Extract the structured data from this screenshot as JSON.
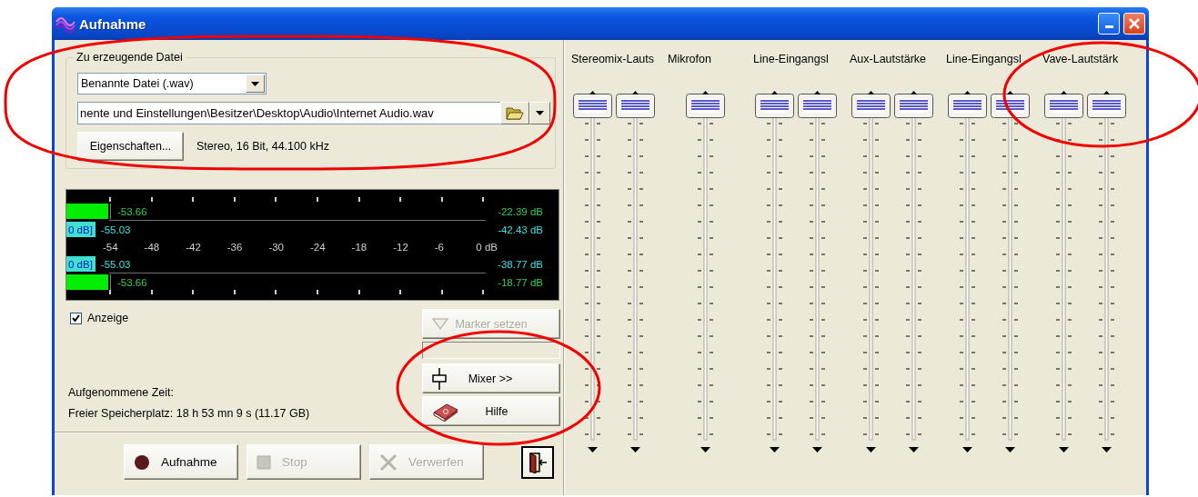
{
  "window": {
    "title": "Aufnahme"
  },
  "file_group": {
    "title": "Zu erzeugende Datei",
    "file_type": "Benannte Datei (.wav)",
    "path": "nente und Einstellungen\\Besitzer\\Desktop\\Audio\\Internet Audio.wav",
    "properties_button": "Eigenschaften...",
    "format": "Stereo, 16 Bit, 44.100 kHz"
  },
  "meter": {
    "rows": [
      {
        "kind": "bar",
        "level": 0.1,
        "value": "-53.66",
        "reading": "-22.39 dB"
      },
      {
        "kind": "tag",
        "tag": "0 dB]",
        "value": "-55.03",
        "reading": "-42.43 dB"
      },
      {
        "kind": "scale",
        "labels": [
          "-54",
          "-48",
          "-42",
          "-36",
          "-30",
          "-24",
          "-18",
          "-12",
          "-6",
          "0 dB"
        ]
      },
      {
        "kind": "tag",
        "tag": "0 dB]",
        "value": "-55.03",
        "reading": "-38.77 dB"
      },
      {
        "kind": "bar",
        "level": 0.1,
        "value": "-53.66",
        "reading": "-18.77 dB"
      }
    ]
  },
  "display_checkbox": {
    "label": "Anzeige",
    "checked": true
  },
  "side_buttons": [
    {
      "kind": "marker",
      "label": "Marker setzen",
      "disabled": true
    },
    {
      "kind": "field"
    },
    {
      "kind": "mixer",
      "label": "Mixer >>",
      "disabled": false
    },
    {
      "kind": "help",
      "label": "Hilfe",
      "disabled": false
    }
  ],
  "recorded_time": "Aufgenommene Zeit:",
  "free_space": "Freier Speicherplatz: 18 h 53 mn 9 s (11.17 GB)",
  "bottom_buttons": [
    {
      "kind": "record",
      "label": "Aufnahme",
      "disabled": false
    },
    {
      "kind": "stop",
      "label": "Stop",
      "disabled": true
    },
    {
      "kind": "discard",
      "label": "Verwerfen",
      "disabled": true
    },
    {
      "kind": "exit",
      "disabled": false
    }
  ],
  "mixer": {
    "channels": [
      {
        "label": "Stereomix-Lauts",
        "sliders": [
          {
            "level": 1
          },
          {
            "level": 1
          }
        ]
      },
      {
        "label": "Mikrofon",
        "sliders": [
          {
            "level": 1
          }
        ]
      },
      {
        "label": "Line-Eingangsl",
        "sliders": [
          {
            "level": 1
          },
          {
            "level": 1
          }
        ]
      },
      {
        "label": "Aux-Lautstärke",
        "sliders": [
          {
            "level": 1
          },
          {
            "level": 1
          }
        ]
      },
      {
        "label": "Line-Eingangsl",
        "sliders": [
          {
            "level": 1
          },
          {
            "level": 1
          }
        ]
      },
      {
        "label": "Vave-Lautstärk",
        "sliders": [
          {
            "level": 1
          },
          {
            "level": 1
          }
        ]
      }
    ]
  }
}
